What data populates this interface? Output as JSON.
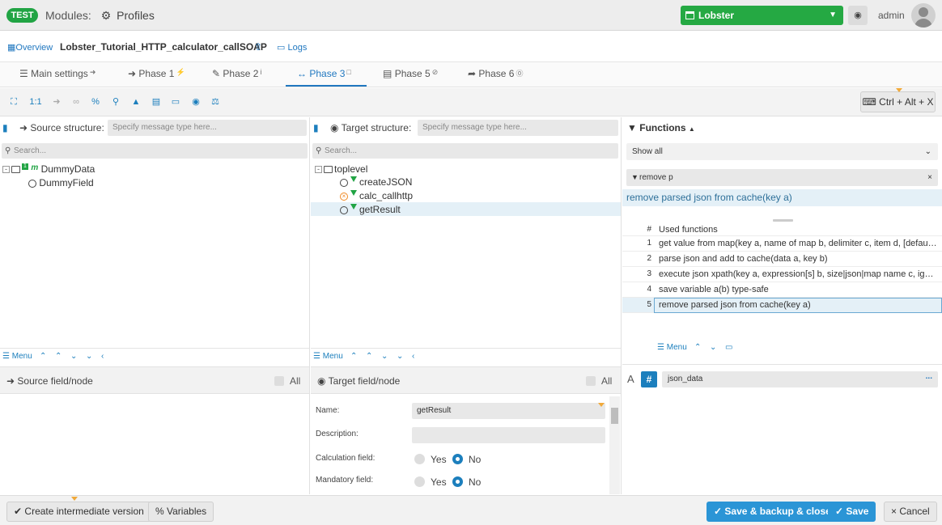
{
  "header": {
    "badge": "TEST",
    "modules_label": "Modules:",
    "profiles_label": "Profiles",
    "env_select": "Lobster",
    "user": "admin"
  },
  "subheader": {
    "overview": "Overview",
    "profile_name": "Lobster_Tutorial_HTTP_calculator_callSOAP",
    "logs": "Logs"
  },
  "tabs": [
    {
      "label": "Main settings"
    },
    {
      "label": "Phase 1"
    },
    {
      "label": "Phase 2"
    },
    {
      "label": "Phase 3"
    },
    {
      "label": "Phase 5"
    },
    {
      "label": "Phase 6"
    }
  ],
  "toolbar": {
    "one_to_one": "1:1",
    "shortcut": "Ctrl + Alt + X"
  },
  "source": {
    "label": "Source structure:",
    "placeholder": "Specify message type here...",
    "search": "Search...",
    "nodes": [
      "DummyData",
      "DummyField"
    ],
    "menu": "Menu",
    "field_header": "Source field/node",
    "all": "All"
  },
  "target": {
    "label": "Target structure:",
    "placeholder": "Specify message type here...",
    "search": "Search...",
    "nodes": [
      "toplevel",
      "createJSON",
      "calc_callhttp",
      "getResult"
    ],
    "menu": "Menu",
    "field_header": "Target field/node",
    "all": "All",
    "form": {
      "name_label": "Name:",
      "name_value": "getResult",
      "description_label": "Description:",
      "calc_label": "Calculation field:",
      "mandatory_label": "Mandatory field:",
      "yes": "Yes",
      "no": "No"
    }
  },
  "functions": {
    "title": "Functions",
    "select": "Show all",
    "filter": "remove p",
    "hit": "remove parsed json from cache(key a)",
    "col_num": "#",
    "col_used": "Used functions",
    "rows": [
      {
        "n": "1",
        "t": "get value from map(key a, name of map b, delimiter c, item d, [default e])"
      },
      {
        "n": "2",
        "t": "parse json and add to cache(data a, key b)"
      },
      {
        "n": "3",
        "t": "execute json xpath(key a, expression[s] b, size|json|map name c, ignore d)"
      },
      {
        "n": "4",
        "t": "save variable a(b) type-safe"
      },
      {
        "n": "5",
        "t": "remove parsed json from cache(key a)"
      }
    ],
    "menu": "Menu",
    "var_prefix": "A",
    "var_hash": "#",
    "variable": "json_data",
    "ellipsis": "..."
  },
  "footer": {
    "create_version": "Create intermediate version",
    "variables": "Variables",
    "save_backup_close": "Save & backup & close",
    "save": "Save",
    "cancel": "Cancel"
  },
  "colors": {
    "accent": "#2178c0",
    "green": "#25a943",
    "save_blue": "#2b95d6"
  }
}
